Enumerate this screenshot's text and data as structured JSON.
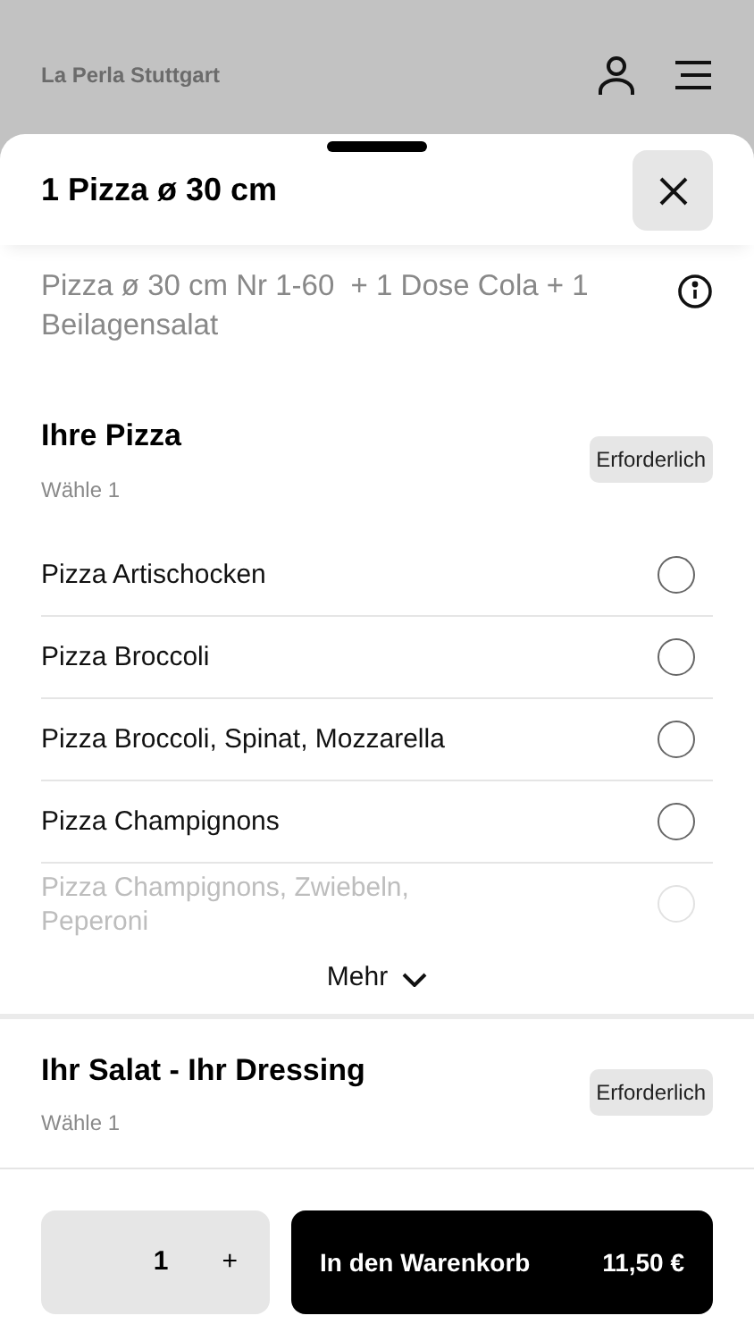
{
  "header": {
    "restaurant": "La Perla Stuttgart"
  },
  "sheet": {
    "title": "1 Pizza ø 30 cm",
    "description": "Pizza ø 30 cm Nr 1-60  + 1 Dose Cola + 1 Beilagensalat"
  },
  "sections": [
    {
      "title": "Ihre Pizza",
      "subtitle": "Wähle 1",
      "badge": "Erforderlich",
      "options": [
        {
          "label": "Pizza Artischocken",
          "selected": false,
          "faded": false
        },
        {
          "label": "Pizza Broccoli",
          "selected": false,
          "faded": false
        },
        {
          "label": "Pizza Broccoli, Spinat, Mozzarella",
          "selected": false,
          "faded": false
        },
        {
          "label": "Pizza Champignons",
          "selected": false,
          "faded": false
        },
        {
          "label": "Pizza Champignons, Zwiebeln, Peperoni",
          "selected": false,
          "faded": true
        }
      ],
      "more": "Mehr"
    },
    {
      "title": "Ihr Salat - Ihr Dressing",
      "subtitle": "Wähle 1",
      "badge": "Erforderlich"
    }
  ],
  "footer": {
    "quantity": "1",
    "increment": "+",
    "add_button": "In den Warenkorb",
    "price": "11,50 €"
  }
}
